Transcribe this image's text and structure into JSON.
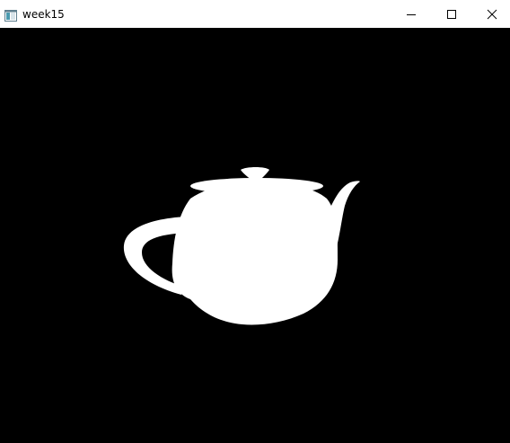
{
  "window": {
    "title": "week15",
    "controls": {
      "minimize": "minimize",
      "maximize": "maximize",
      "close": "close"
    }
  },
  "viewport": {
    "background": "#000000",
    "object_color": "#ffffff",
    "object": "teapot"
  }
}
